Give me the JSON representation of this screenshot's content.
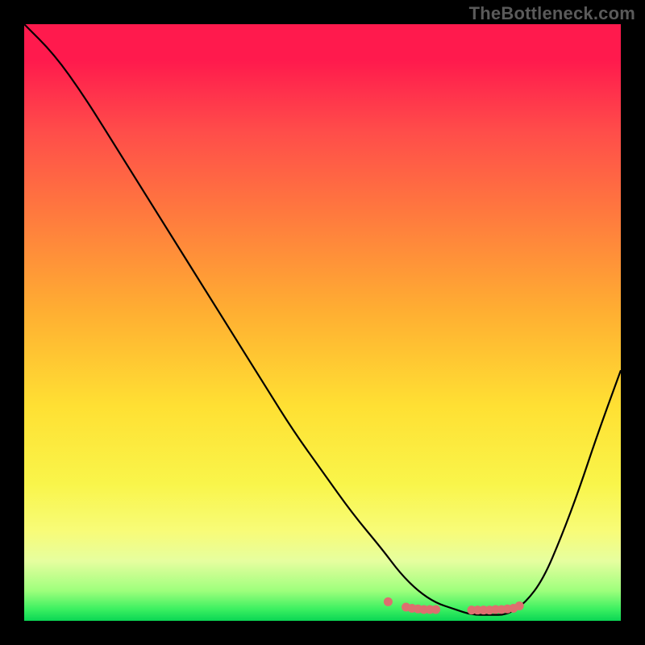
{
  "watermark": "TheBottleneck.com",
  "chart_data": {
    "type": "line",
    "title": "",
    "xlabel": "",
    "ylabel": "",
    "xlim": [
      0,
      100
    ],
    "ylim": [
      0,
      100
    ],
    "x": [
      0,
      5,
      10,
      15,
      20,
      25,
      30,
      35,
      40,
      45,
      50,
      55,
      60,
      63,
      66,
      69,
      72,
      75,
      78,
      81,
      84,
      87,
      90,
      93,
      96,
      100
    ],
    "values": [
      100,
      95,
      88,
      80,
      72,
      64,
      56,
      48,
      40,
      32,
      25,
      18,
      12,
      8,
      5,
      3,
      2,
      1,
      1,
      1,
      3,
      7,
      14,
      22,
      31,
      42
    ],
    "markers_x": [
      61,
      64,
      65,
      66,
      67,
      68,
      69,
      75,
      76,
      77,
      78,
      79,
      80,
      81,
      82,
      83
    ],
    "markers_y": [
      3.2,
      2.3,
      2.1,
      2.0,
      1.9,
      1.9,
      1.9,
      1.8,
      1.8,
      1.8,
      1.8,
      1.9,
      1.9,
      2.0,
      2.1,
      2.5
    ],
    "marker_color": "#dd6f6f",
    "gradient_stops": [
      {
        "pos": 0.0,
        "color": "#ff1a4d"
      },
      {
        "pos": 0.18,
        "color": "#ff4d4a"
      },
      {
        "pos": 0.32,
        "color": "#ff7a3e"
      },
      {
        "pos": 0.48,
        "color": "#ffae32"
      },
      {
        "pos": 0.64,
        "color": "#ffe033"
      },
      {
        "pos": 0.77,
        "color": "#f9f54a"
      },
      {
        "pos": 0.9,
        "color": "#e6fe9f"
      },
      {
        "pos": 0.97,
        "color": "#3df061"
      },
      {
        "pos": 1.0,
        "color": "#0ad654"
      }
    ]
  }
}
